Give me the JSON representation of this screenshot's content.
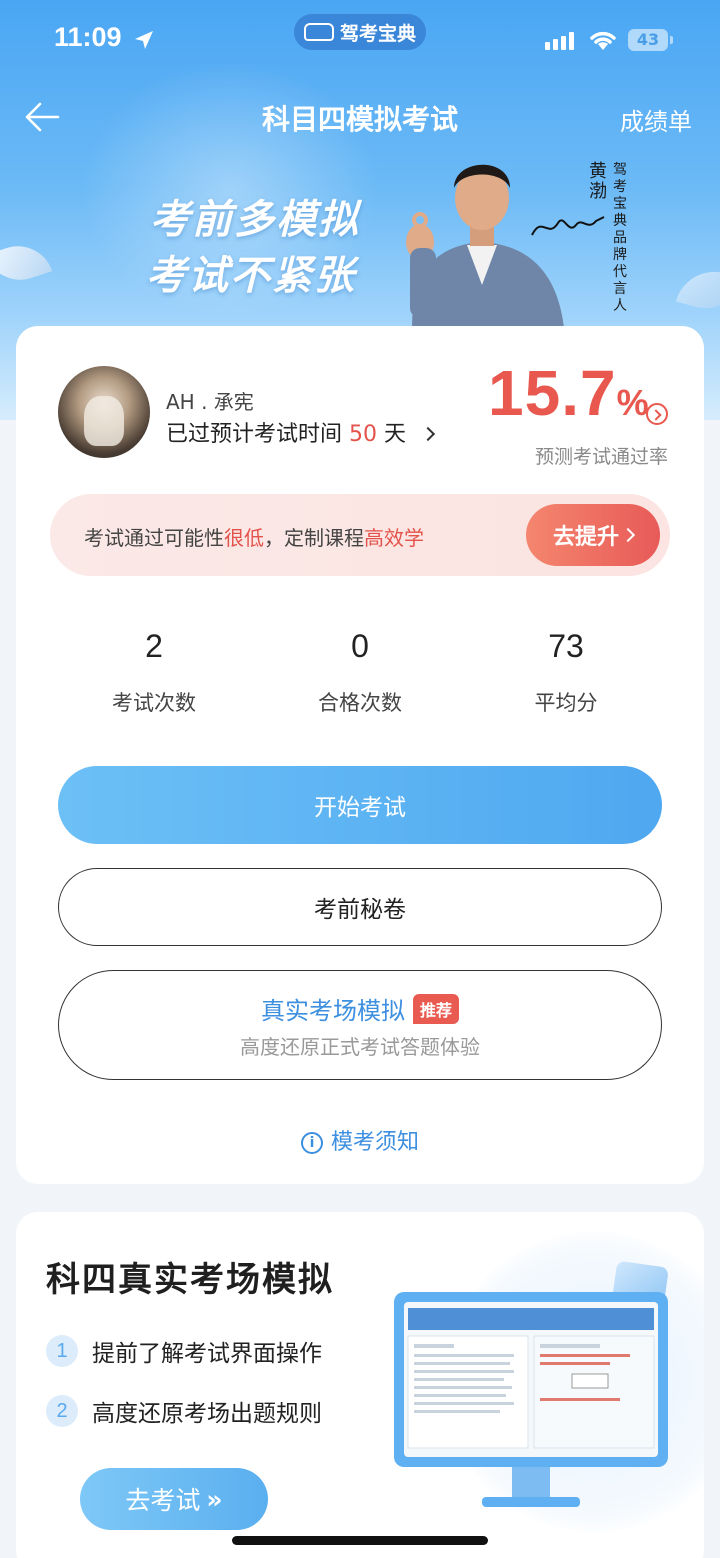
{
  "status": {
    "time": "11:09",
    "battery": "43",
    "app_name": "驾考宝典"
  },
  "nav": {
    "title": "科目四模拟考试",
    "right": "成绩单"
  },
  "banner": {
    "slogan1": "考前多模拟",
    "slogan2": "考试不紧张",
    "endorser_name": "黄渤",
    "endorser_title": "驾考宝典品牌代言人"
  },
  "user": {
    "name": "AH . 承宪",
    "info_prefix": "已过预计考试时间",
    "days": "50",
    "days_unit": "天"
  },
  "prediction": {
    "rate": "15.7",
    "pct": "%",
    "label": "预测考试通过率"
  },
  "tip": {
    "text1": "考试通过可能性",
    "hl1": "很低",
    "text2": "，定制课程",
    "hl2": "高效学",
    "button": "去提升"
  },
  "stats": [
    {
      "value": "2",
      "label": "考试次数"
    },
    {
      "value": "0",
      "label": "合格次数"
    },
    {
      "value": "73",
      "label": "平均分"
    }
  ],
  "buttons": {
    "start": "开始考试",
    "secret": "考前秘卷",
    "real_title": "真实考场模拟",
    "real_badge": "推荐",
    "real_sub": "高度还原正式考试答题体验"
  },
  "notice": "模考须知",
  "promo": {
    "title": "科四真实考场模拟",
    "items": [
      "提前了解考试界面操作",
      "高度还原考场出题规则"
    ],
    "button": "去考试"
  },
  "colors": {
    "accent_blue": "#4fa8f0",
    "accent_red": "#e8584e"
  }
}
